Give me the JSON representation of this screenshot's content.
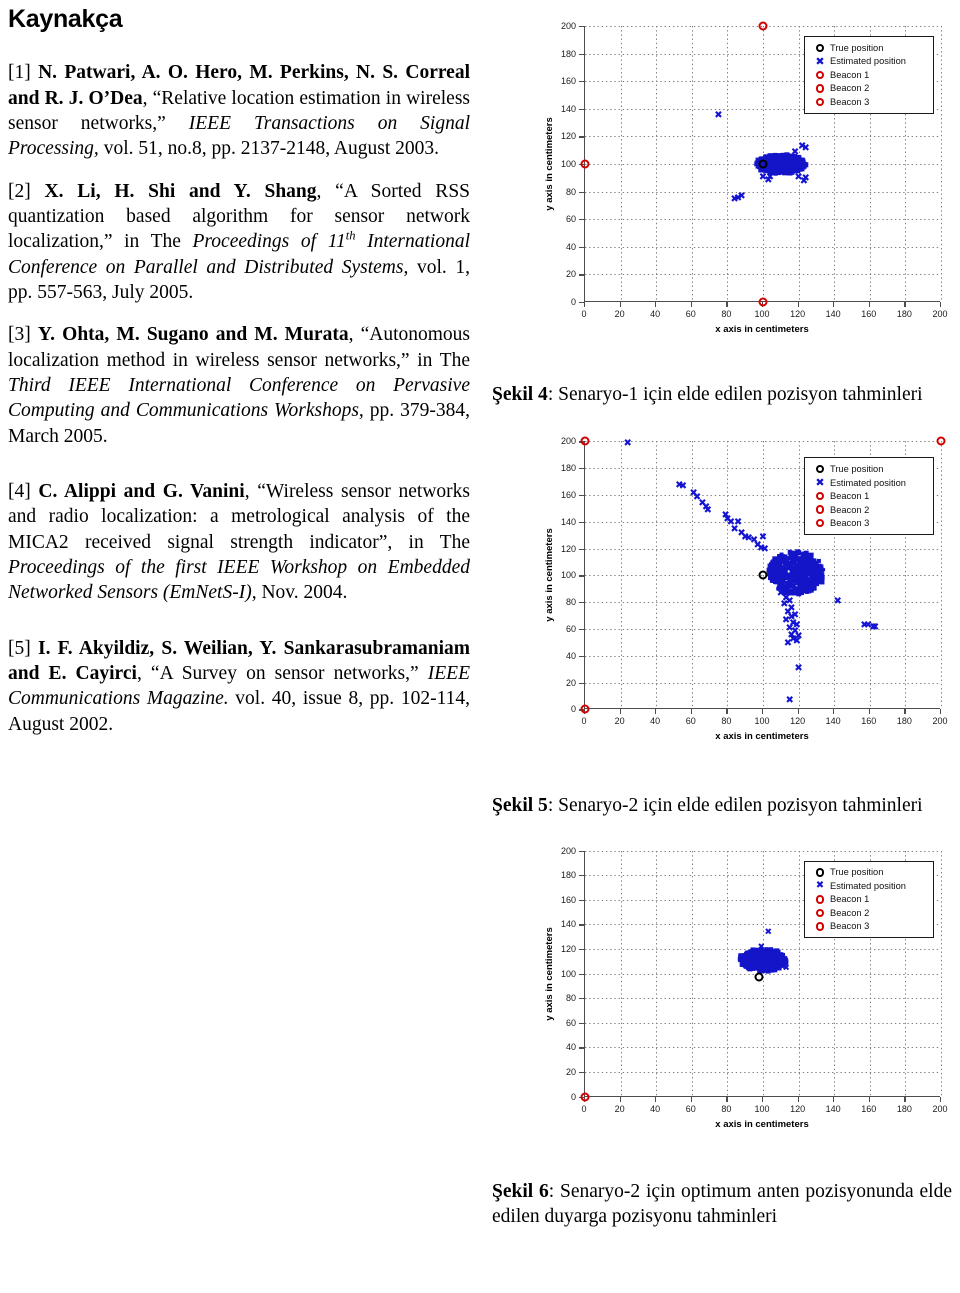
{
  "document": {
    "title": "Kaynakça",
    "references": [
      {
        "id": "ref-1",
        "marker": "[1]",
        "authors": "N. Patwari, A. O. Hero, M. Perkins, N. S. Correal and R. J. O’Dea",
        "text_before_italic": ", “Relative location estimation in wireless sensor networks,” ",
        "italic": "IEEE Transactions on Signal Processing,",
        "text_after_italic": " vol. 51, no.8, pp. 2137-2148, August 2003."
      },
      {
        "id": "ref-2",
        "marker": "[2]",
        "authors": "X. Li, H. Shi and Y. Shang",
        "text_before_italic": ", “A Sorted RSS quantization based algorithm for sensor network localization,” in The ",
        "italic": "Proceedings of 11",
        "superscript": "th",
        "italic_cont": " International Conference on Parallel and Distributed Systems,",
        "text_after_italic": " vol. 1, pp. 557-563, July 2005."
      },
      {
        "id": "ref-3",
        "marker": "[3]",
        "authors": "Y. Ohta, M. Sugano and M. Murata",
        "text_before_italic": ", “Autonomous localization method in wireless sensor networks,” in The ",
        "italic": "Third IEEE International Conference on Pervasive Computing and Communications Workshops,",
        "text_after_italic": " pp. 379-384, March 2005."
      },
      {
        "id": "ref-4",
        "marker": "[4]",
        "authors": "C. Alippi and G. Vanini",
        "text_before_italic": ", “Wireless sensor networks and radio localization: a metrological analysis of the MICA2 received signal strength indicator”, in The ",
        "italic": "Proceedings of the first IEEE Workshop on Embedded Networked Sensors (EmNetS-I),",
        "text_after_italic": " Nov. 2004."
      },
      {
        "id": "ref-5",
        "marker": "[5]",
        "authors": "I. F. Akyildiz, S. Weilian, Y. Sankarasubramaniam and E. Cayirci",
        "text_before_italic": ", “A Survey on sensor networks,” ",
        "italic": "IEEE Communications Magazine.",
        "text_after_italic": " vol. 40, issue 8, pp. 102-114, August 2002."
      }
    ]
  },
  "figures": [
    {
      "id": "figure-4",
      "caption_label": "Şekil 4",
      "caption_text": ": Senaryo-1 için elde edilen pozisyon tahminleri"
    },
    {
      "id": "figure-5",
      "caption_label": "Şekil 5",
      "caption_text": ": Senaryo-2 için elde edilen pozisyon tahminleri"
    },
    {
      "id": "figure-6",
      "caption_label": "Şekil 6",
      "caption_text": ": Senaryo-2 için optimum anten pozisyonunda elde edilen duyarga pozisyonu tahminleri"
    }
  ],
  "legend": {
    "entries": [
      {
        "label": "True position",
        "marker": "circle-black"
      },
      {
        "label": "Estimated position",
        "marker": "x-blue"
      },
      {
        "label": "Beacon 1",
        "marker": "circle-red"
      },
      {
        "label": "Beacon 2",
        "marker": "circle-red"
      },
      {
        "label": "Beacon 3",
        "marker": "circle-red"
      }
    ]
  },
  "colors": {
    "estimated": "#1414c8",
    "beacon": "#d40000",
    "true_position": "#000000",
    "axis": "#4d4d4d",
    "grid": "#808080"
  },
  "chart_data": [
    {
      "id": "figure-4",
      "type": "scatter",
      "title": "",
      "xlabel": "x axis in centimeters",
      "ylabel": "y axis in centimeters",
      "xlim": [
        0,
        200
      ],
      "ylim": [
        0,
        200
      ],
      "xticks": [
        0,
        20,
        40,
        60,
        80,
        100,
        120,
        140,
        160,
        180,
        200
      ],
      "yticks": [
        0,
        20,
        40,
        60,
        80,
        100,
        120,
        140,
        160,
        180,
        200
      ],
      "grid": true,
      "legend_position": "top-right",
      "series": [
        {
          "name": "True position",
          "marker": "circle-black",
          "points": [
            [
              100,
              100
            ]
          ]
        },
        {
          "name": "Beacons",
          "marker": "circle-red",
          "points": [
            [
              100,
              200
            ],
            [
              0,
              100
            ],
            [
              100,
              0
            ]
          ]
        },
        {
          "name": "Estimated position",
          "marker": "x-blue",
          "cluster_center": [
            110,
            100
          ],
          "cluster_spread": [
            14,
            7
          ],
          "outliers": [
            [
              75,
              135
            ],
            [
              122,
              112
            ],
            [
              124,
              111
            ],
            [
              118,
              108
            ],
            [
              104,
              90
            ],
            [
              100,
              90
            ],
            [
              103,
              88
            ],
            [
              120,
              90
            ],
            [
              124,
              89
            ],
            [
              123,
              87
            ],
            [
              86,
              75
            ],
            [
              88,
              76
            ],
            [
              84,
              74
            ]
          ]
        }
      ]
    },
    {
      "id": "figure-5",
      "type": "scatter",
      "title": "",
      "xlabel": "x axis in centimeters",
      "ylabel": "y axis in centimeters",
      "xlim": [
        0,
        200
      ],
      "ylim": [
        0,
        200
      ],
      "xticks": [
        0,
        20,
        40,
        60,
        80,
        100,
        120,
        140,
        160,
        180,
        200
      ],
      "yticks": [
        0,
        20,
        40,
        60,
        80,
        100,
        120,
        140,
        160,
        180,
        200
      ],
      "grid": true,
      "legend_position": "top-right",
      "series": [
        {
          "name": "True position",
          "marker": "circle-black",
          "points": [
            [
              100,
              100
            ]
          ]
        },
        {
          "name": "Beacons",
          "marker": "circle-red",
          "points": [
            [
              0,
              200
            ],
            [
              200,
              200
            ],
            [
              0,
              0
            ]
          ]
        },
        {
          "name": "Estimated position",
          "marker": "x-blue",
          "cluster_center": [
            119,
            102
          ],
          "cluster_spread": [
            16,
            16
          ],
          "outliers": [
            [
              24,
              198
            ],
            [
              53,
              167
            ],
            [
              55,
              166
            ],
            [
              61,
              161
            ],
            [
              63,
              158
            ],
            [
              66,
              153
            ],
            [
              68,
              150
            ],
            [
              69,
              148
            ],
            [
              79,
              144
            ],
            [
              80,
              141
            ],
            [
              82,
              139
            ],
            [
              86,
              139
            ],
            [
              84,
              134
            ],
            [
              88,
              131
            ],
            [
              90,
              128
            ],
            [
              92,
              127
            ],
            [
              95,
              126
            ],
            [
              100,
              128
            ],
            [
              97,
              122
            ],
            [
              99,
              120
            ],
            [
              101,
              119
            ],
            [
              112,
              88
            ],
            [
              110,
              86
            ],
            [
              113,
              82
            ],
            [
              115,
              80
            ],
            [
              112,
              78
            ],
            [
              116,
              75
            ],
            [
              114,
              72
            ],
            [
              118,
              70
            ],
            [
              116,
              68
            ],
            [
              113,
              66
            ],
            [
              117,
              64
            ],
            [
              119,
              62
            ],
            [
              115,
              60
            ],
            [
              118,
              58
            ],
            [
              116,
              55
            ],
            [
              120,
              54
            ],
            [
              117,
              52
            ],
            [
              119,
              50
            ],
            [
              114,
              49
            ],
            [
              142,
              80
            ],
            [
              157,
              62
            ],
            [
              159,
              62
            ],
            [
              162,
              61
            ],
            [
              163,
              61
            ],
            [
              120,
              30
            ],
            [
              115,
              6
            ]
          ]
        }
      ]
    },
    {
      "id": "figure-6",
      "type": "scatter",
      "title": "",
      "xlabel": "x axis in centimeters",
      "ylabel": "y axis in centimeters",
      "xlim": [
        0,
        200
      ],
      "ylim": [
        0,
        200
      ],
      "xticks": [
        0,
        20,
        40,
        60,
        80,
        100,
        120,
        140,
        160,
        180,
        200
      ],
      "yticks": [
        0,
        20,
        40,
        60,
        80,
        100,
        120,
        140,
        160,
        180,
        200
      ],
      "grid": true,
      "legend_position": "top-right",
      "series": [
        {
          "name": "True position",
          "marker": "circle-black",
          "points": [
            [
              98,
              97
            ]
          ]
        },
        {
          "name": "Beacons",
          "marker": "circle-red",
          "points": [
            [
              0,
              0
            ]
          ]
        },
        {
          "name": "Estimated position",
          "marker": "x-blue",
          "cluster_center": [
            100,
            111
          ],
          "cluster_spread": [
            13,
            9
          ],
          "outliers": [
            [
              103,
              133
            ],
            [
              99,
              121
            ],
            [
              111,
              105
            ],
            [
              113,
              104
            ]
          ]
        }
      ]
    }
  ]
}
